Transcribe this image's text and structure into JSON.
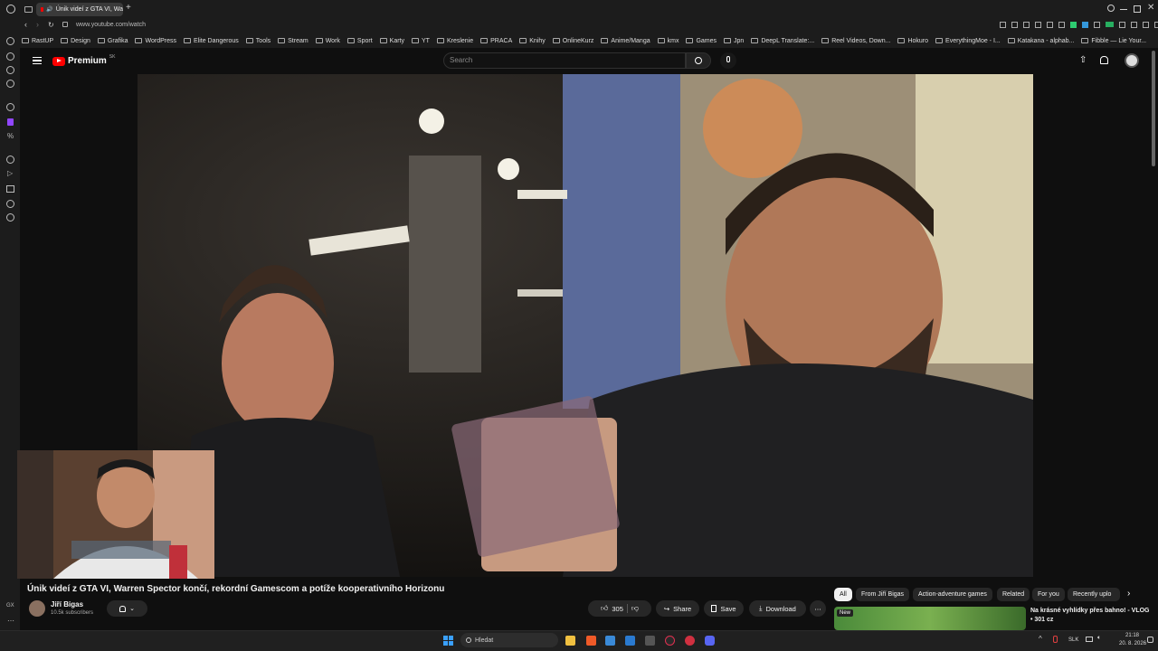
{
  "browser": {
    "tab_title": "Únik videí z GTA VI, Wa",
    "url": "www.youtube.com/watch",
    "bookmarks": [
      "RastUP",
      "Design",
      "Grafika",
      "WordPress",
      "Elite Dangerous",
      "Tools",
      "Stream",
      "Work",
      "Sport",
      "Karty",
      "YT",
      "Kreslenie",
      "PRACA",
      "Knihy",
      "OnlineKurz",
      "Anime/Manga",
      "kmx",
      "Games",
      "Jpn",
      "DeepL Translate:...",
      "Reel Videos, Down...",
      "Hokuro",
      "EverythingMoe - I...",
      "Katakana - alphab...",
      "Fibble — Lie Your..."
    ]
  },
  "youtube": {
    "logo": "Premium",
    "logo_badge": "SK",
    "search_placeholder": "Search",
    "video_title": "Únik videí z GTA VI, Warren Spector končí, rekordní Gamescom a potíže kooperativního Horizonu",
    "channel_name": "Jiří Bigas",
    "subscribers": "10.5k subscribers",
    "likes": "305",
    "share_label": "Share",
    "save_label": "Save",
    "download_label": "Download",
    "chips": [
      "All",
      "From Jiří Bigas",
      "Action-adventure games",
      "Related",
      "For you",
      "Recently uplo"
    ],
    "rec_title": "Na krásné vyhlídky přes bahno! - VLOG",
    "rec_sub": "• 301 cz",
    "rec_badge": "New"
  },
  "sidebar_badge": "GX",
  "taskbar": {
    "search_placeholder": "Hledat",
    "language": "SLK",
    "time": "21:18",
    "date": "20. 8. 2026"
  }
}
